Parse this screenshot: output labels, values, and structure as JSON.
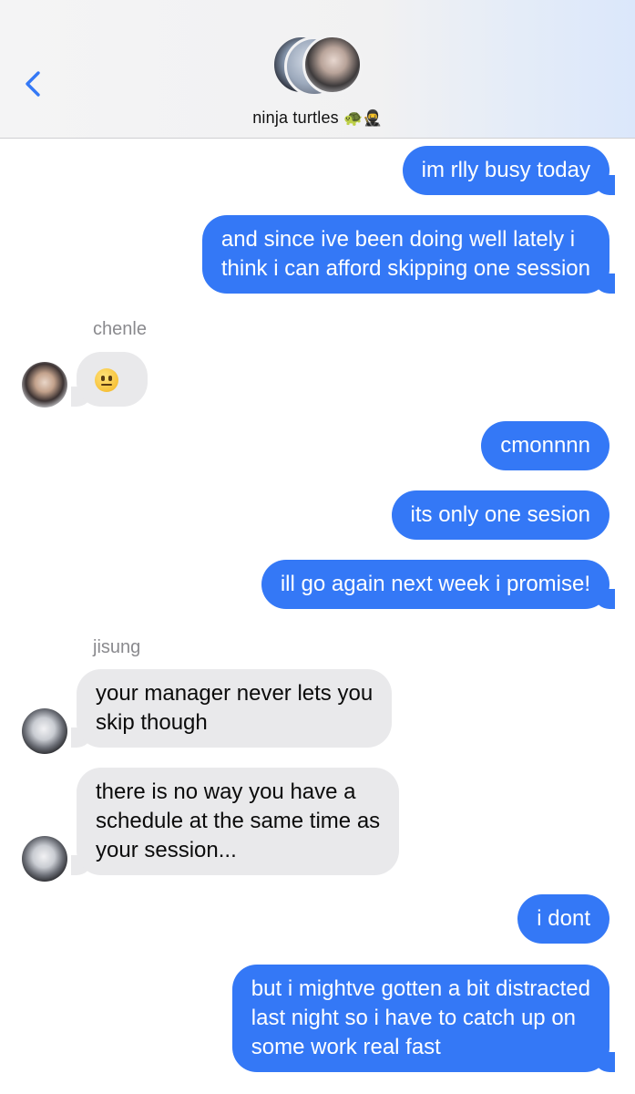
{
  "header": {
    "title": "ninja turtles",
    "title_emoji": "🐢🥷",
    "back_icon": "chevron-left-icon"
  },
  "colors": {
    "outgoing_bubble": "#3478f6",
    "incoming_bubble": "#e9e9eb",
    "accent": "#3478f6"
  },
  "messages": [
    {
      "dir": "out",
      "lines": [
        "im rlly busy today"
      ]
    },
    {
      "dir": "out",
      "lines": [
        "and since ive been doing well lately i",
        "think i can afford skipping one session"
      ]
    },
    {
      "dir": "in",
      "sender": "chenle",
      "lines": [
        "😐"
      ]
    },
    {
      "dir": "out",
      "lines": [
        "cmonnnn"
      ]
    },
    {
      "dir": "out",
      "lines": [
        "its only one sesion"
      ]
    },
    {
      "dir": "out",
      "lines": [
        "ill go again next week i promise!"
      ]
    },
    {
      "dir": "in",
      "sender": "jisung",
      "lines": [
        "your manager never lets you",
        "skip though"
      ]
    },
    {
      "dir": "in",
      "lines": [
        "there is no way you have a",
        "schedule at the same time as",
        "your session..."
      ]
    },
    {
      "dir": "out",
      "lines": [
        "i dont"
      ]
    },
    {
      "dir": "out",
      "lines": [
        "but i mightve gotten a bit distracted",
        "last night so i have to catch up on",
        "some work real fast"
      ]
    }
  ]
}
